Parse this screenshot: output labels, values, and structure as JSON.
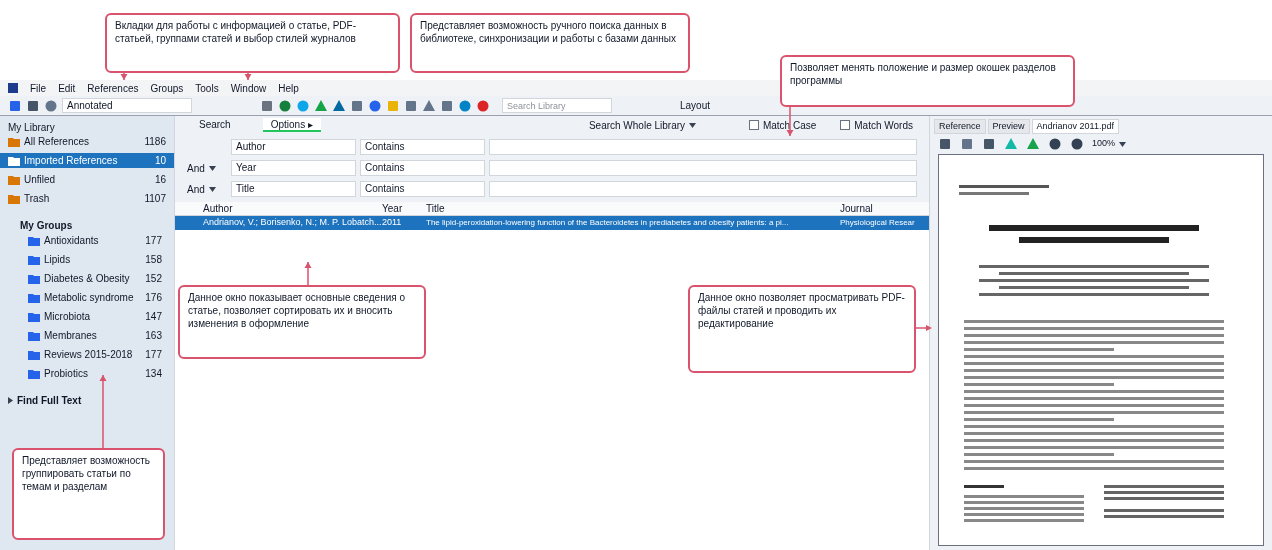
{
  "menu": [
    "File",
    "Edit",
    "References",
    "Groups",
    "Tools",
    "Window",
    "Help"
  ],
  "library_selector": {
    "value": "Annotated"
  },
  "quick_search": {
    "placeholder": "Search Library"
  },
  "layout_menu": {
    "value": "Layout"
  },
  "sidebar": {
    "header": "My Library",
    "items": [
      {
        "label": "All References",
        "count": "1186",
        "selected": false
      },
      {
        "label": "Imported References",
        "count": "10",
        "selected": true
      },
      {
        "label": "Unfiled",
        "count": "16",
        "selected": false
      },
      {
        "label": "Trash",
        "count": "1107",
        "selected": false
      }
    ],
    "groups_header": "My Groups",
    "groups": [
      {
        "label": "Antioxidants",
        "count": "177"
      },
      {
        "label": "Lipids",
        "count": "158"
      },
      {
        "label": "Diabetes & Obesity",
        "count": "152"
      },
      {
        "label": "Metabolic syndrome",
        "count": "176"
      },
      {
        "label": "Microbiota",
        "count": "147"
      },
      {
        "label": "Membranes",
        "count": "163"
      },
      {
        "label": "Reviews 2015-2018",
        "count": "177"
      },
      {
        "label": "Probiotics",
        "count": "134"
      }
    ],
    "find_full_text": "Find Full Text"
  },
  "search_panel": {
    "tabs": [
      {
        "label": "Search",
        "selected": false
      },
      {
        "label": "Options ▸",
        "selected": true
      }
    ],
    "scope": "Search Whole Library",
    "match_case": {
      "label": "Match Case",
      "checked": false
    },
    "match_words": {
      "label": "Match Words",
      "checked": false
    },
    "rows": [
      {
        "operator": "",
        "field": "Author",
        "condition": "Contains"
      },
      {
        "operator": "And",
        "field": "Year",
        "condition": "Contains"
      },
      {
        "operator": "And",
        "field": "Title",
        "condition": "Contains"
      }
    ]
  },
  "table": {
    "columns": [
      "Author",
      "Year",
      "Title",
      "Journal"
    ],
    "rows": [
      {
        "author": "Andrianov, V.; Borisenko, N.; M. P. Lobatch...",
        "year": "2011",
        "title": "The lipid-peroxidation-lowering function of the Bacteroidetes in prediabetes and obesity patients: a pi...",
        "journal": "Physiological Resear",
        "selected": true
      }
    ]
  },
  "reference_panel": {
    "tabs": [
      {
        "label": "Reference",
        "selected": false
      },
      {
        "label": "Preview",
        "selected": false
      },
      {
        "label": "Andrianov 2011.pdf",
        "selected": true
      }
    ],
    "zoom": "100%"
  },
  "annotations": [
    "Вкладки для работы с информацией о статье, PDF-статьей, группами статей и выбор стилей журналов",
    "Представляет возможность ручного поиска данных в библиотеке, синхронизации и работы с базами данных",
    "Позволяет менять положение и размер окошек разделов программы",
    "Данное окно показывает основные сведения о статье, позволяет сортировать их и вносить изменения в оформление",
    "Данное окно позволяет просматривать PDF-файлы статей и проводить их редактирование",
    "Представляет возможность группировать статьи по темам и разделам"
  ]
}
